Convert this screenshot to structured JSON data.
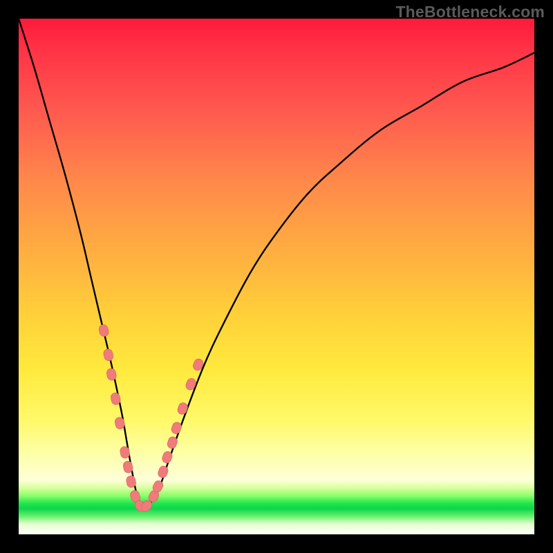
{
  "watermark": {
    "text": "TheBottleneck.com"
  },
  "colors": {
    "frame": "#000000",
    "curve_stroke": "#000000",
    "marker_fill": "#ef7b7b",
    "marker_stroke": "#d85f5f"
  },
  "chart_data": {
    "type": "line",
    "title": "",
    "xlabel": "",
    "ylabel": "",
    "xlim": [
      0,
      100
    ],
    "ylim": [
      0,
      100
    ],
    "grid": false,
    "series": [
      {
        "name": "bottleneck-curve",
        "comment": "V-shaped bottleneck curve; values approximated from gridlines (implied). y=0 ≈ green band near bottom, y=100 ≈ top.",
        "x": [
          0,
          3,
          6,
          9,
          12,
          14,
          16,
          18,
          20,
          21,
          22,
          23,
          24,
          25,
          27,
          29,
          32,
          36,
          40,
          45,
          50,
          56,
          62,
          70,
          78,
          86,
          94,
          100
        ],
        "y": [
          100,
          90,
          79,
          68,
          56,
          47,
          38,
          29,
          19,
          13,
          7,
          2,
          0,
          0,
          3,
          9,
          18,
          29,
          38,
          48,
          56,
          64,
          70,
          77,
          82,
          87,
          90,
          93
        ]
      }
    ],
    "markers": {
      "comment": "Salmon capsule markers clustered on both sides of the V near the bottom (where curve intersects pale band).",
      "points": [
        {
          "x": 16.5,
          "y": 36
        },
        {
          "x": 17.4,
          "y": 31
        },
        {
          "x": 18.0,
          "y": 27
        },
        {
          "x": 18.8,
          "y": 22
        },
        {
          "x": 19.6,
          "y": 17
        },
        {
          "x": 20.6,
          "y": 11
        },
        {
          "x": 21.2,
          "y": 8
        },
        {
          "x": 21.8,
          "y": 5
        },
        {
          "x": 22.6,
          "y": 2
        },
        {
          "x": 23.6,
          "y": 0
        },
        {
          "x": 24.8,
          "y": 0
        },
        {
          "x": 26.2,
          "y": 2
        },
        {
          "x": 27.0,
          "y": 4
        },
        {
          "x": 28.0,
          "y": 7
        },
        {
          "x": 28.8,
          "y": 10
        },
        {
          "x": 29.8,
          "y": 13
        },
        {
          "x": 30.6,
          "y": 16
        },
        {
          "x": 31.8,
          "y": 20
        },
        {
          "x": 33.4,
          "y": 25
        },
        {
          "x": 34.8,
          "y": 29
        }
      ]
    }
  }
}
